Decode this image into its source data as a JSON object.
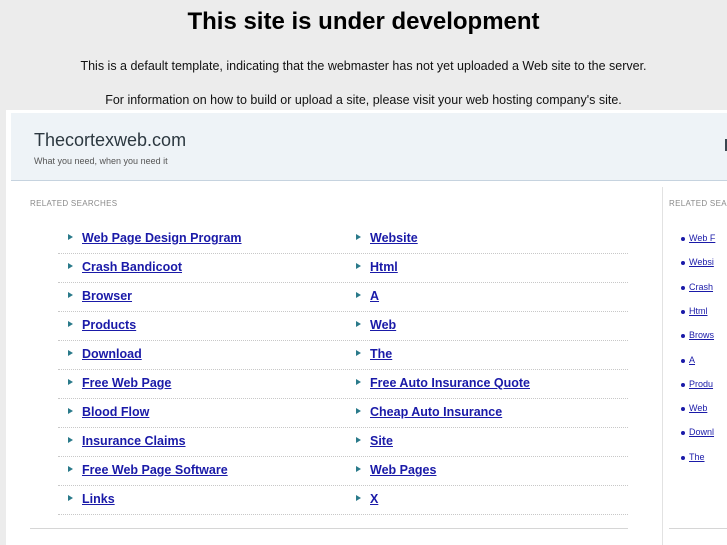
{
  "notice": {
    "title": "This site is under development",
    "line1": "This is a default template, indicating that the webmaster has not yet uploaded a Web site to the server.",
    "line2": "For information on how to build or upload a site, please visit your web hosting company's site."
  },
  "header": {
    "site_name": "Thecortexweb.com",
    "tagline": "What you need, when you need it"
  },
  "main": {
    "heading": "RELATED SEARCHES",
    "rows": [
      [
        "Web Page Design Program",
        "Website"
      ],
      [
        "Crash Bandicoot",
        "Html"
      ],
      [
        "Browser",
        "A"
      ],
      [
        "Products",
        "Web"
      ],
      [
        "Download",
        "The"
      ],
      [
        "Free Web Page",
        "Free Auto Insurance Quote"
      ],
      [
        "Blood Flow",
        "Cheap Auto Insurance"
      ],
      [
        "Insurance Claims",
        "Site"
      ],
      [
        "Free Web Page Software",
        "Web Pages"
      ],
      [
        "Links",
        "X"
      ]
    ]
  },
  "sidebar": {
    "heading": "RELATED SEA",
    "items": [
      "Web F",
      "Websi",
      "Crash",
      "Html",
      "Brows",
      "A",
      "Produ",
      "Web",
      "Downl",
      "The"
    ]
  }
}
